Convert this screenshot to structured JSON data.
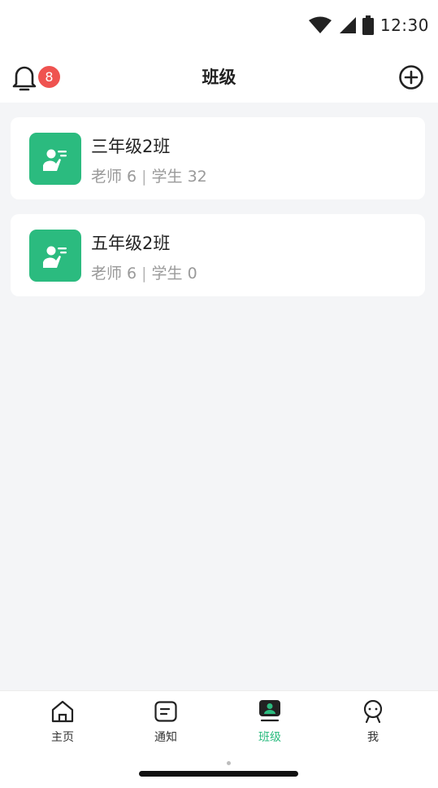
{
  "status_bar": {
    "time": "12:30"
  },
  "header": {
    "title": "班级",
    "notification_count": "8"
  },
  "classes": [
    {
      "name": "三年级2班",
      "teachers": "老师 6",
      "students": "学生 32"
    },
    {
      "name": "五年级2班",
      "teachers": "老师 6",
      "students": "学生 0"
    }
  ],
  "bottom_nav": {
    "items": [
      {
        "label": "主页",
        "icon": "home-icon"
      },
      {
        "label": "通知",
        "icon": "message-icon"
      },
      {
        "label": "班级",
        "icon": "class-icon",
        "active": true
      },
      {
        "label": "我",
        "icon": "profile-icon"
      }
    ]
  },
  "colors": {
    "accent": "#2bbb7f",
    "badge": "#ef5350",
    "background": "#f4f5f7"
  }
}
